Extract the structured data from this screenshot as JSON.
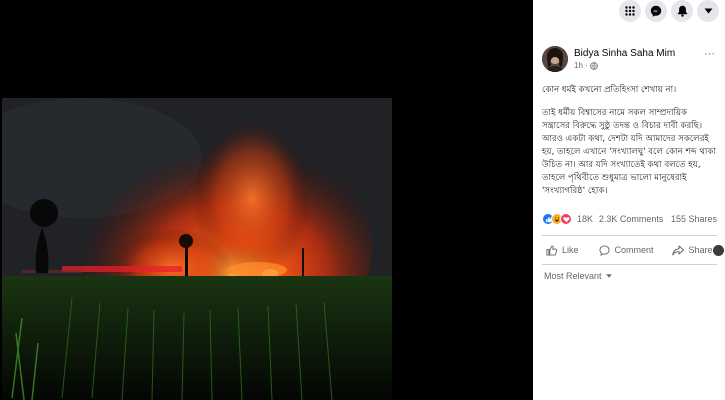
{
  "post": {
    "author": "Bidya Sinha Saha Mim",
    "time": "1h",
    "privacy_icon": "globe-icon",
    "more_label": "···",
    "paragraphs": [
      "কোন ধর্মই কখনো প্রতিহিংসা শেখায় না।",
      "তাই ধর্মীয় বিশ্বাসের নামে সকল সাম্প্রদায়িক সন্ত্রাসের বিরুদ্ধে সুষ্ঠু তদন্ত ও বিচার দাবী করছি। আরও একটা কথা, দেশটা যদি আমাদের সকলেরই হয়, তাহলে এখানে 'সংখ্যালঘু' বলে কোন শব্দ থাকা উচিত না। আর যদি সংখ্যাতেই কথা বলতে হয়, তাহলে পৃথিবীতে শুধুমাত্র ভালো মানুষেরাই 'সংখ্যাগরিষ্ঠ' হোক।"
    ]
  },
  "stats": {
    "reactions": [
      "like-icon",
      "haha-icon",
      "love-icon"
    ],
    "reaction_count": "18K",
    "comments": "2.3K Comments",
    "shares": "155 Shares"
  },
  "actions": {
    "like": "Like",
    "comment": "Comment",
    "share": "Share"
  },
  "comments": {
    "sort_label": "Most Relevant"
  },
  "colors": {
    "facebook_blue": "#1877f2",
    "text_secondary": "#65676b",
    "fire_orange": "#ff4a12"
  }
}
